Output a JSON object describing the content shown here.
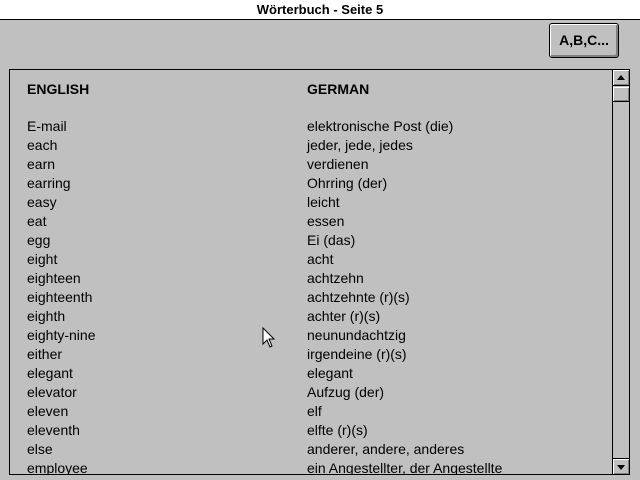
{
  "window": {
    "title": "Wörterbuch - Seite 5"
  },
  "toolbar": {
    "abc_label": "A,B,C..."
  },
  "list": {
    "header_english": "ENGLISH",
    "header_german": "GERMAN",
    "rows": [
      {
        "en": "E-mail",
        "de": "elektronische Post (die)"
      },
      {
        "en": "each",
        "de": "jeder, jede, jedes"
      },
      {
        "en": "earn",
        "de": "verdienen"
      },
      {
        "en": "earring",
        "de": "Ohrring (der)"
      },
      {
        "en": "easy",
        "de": "leicht"
      },
      {
        "en": "eat",
        "de": "essen"
      },
      {
        "en": "egg",
        "de": "Ei (das)"
      },
      {
        "en": "eight",
        "de": "acht"
      },
      {
        "en": "eighteen",
        "de": "achtzehn"
      },
      {
        "en": "eighteenth",
        "de": "achtzehnte (r)(s)"
      },
      {
        "en": "eighth",
        "de": "achter (r)(s)"
      },
      {
        "en": "eighty-nine",
        "de": "neunundachtzig"
      },
      {
        "en": "either",
        "de": "irgendeine (r)(s)"
      },
      {
        "en": "elegant",
        "de": "elegant"
      },
      {
        "en": "elevator",
        "de": "Aufzug (der)"
      },
      {
        "en": "eleven",
        "de": "elf"
      },
      {
        "en": "eleventh",
        "de": "elfte (r)(s)"
      },
      {
        "en": "else",
        "de": "anderer, andere, anderes"
      },
      {
        "en": "employee",
        "de": " ein Angestellter, der Angestellte"
      }
    ]
  },
  "icons": {
    "scroll_up": "arrow-up-icon",
    "scroll_down": "arrow-down-icon",
    "cursor": "mouse-pointer-icon"
  }
}
